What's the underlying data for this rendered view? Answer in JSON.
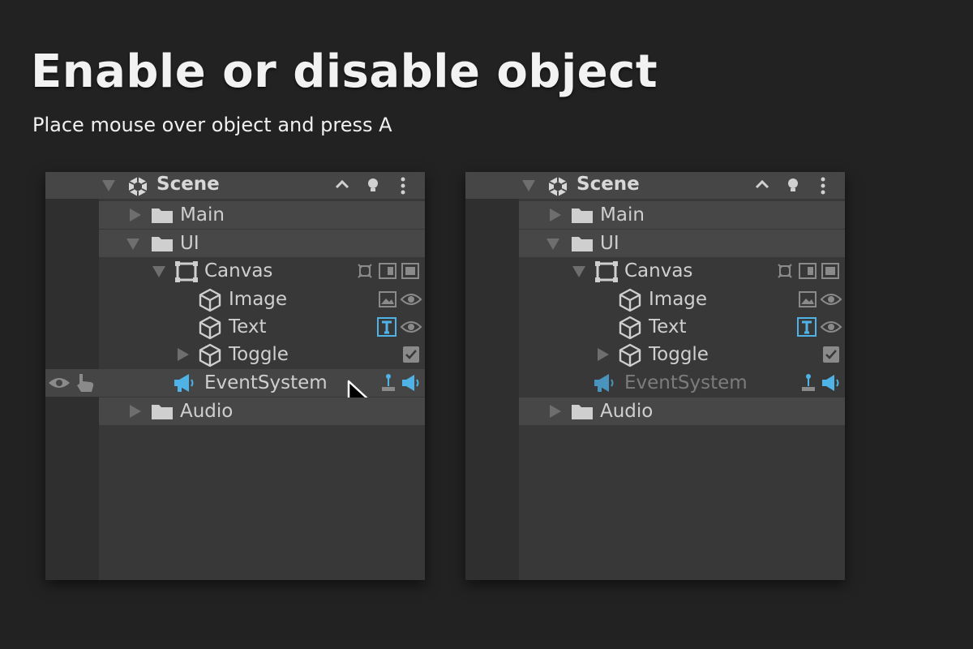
{
  "heading": {
    "title": "Enable or disable object",
    "subtitle": "Place mouse over object and press A"
  },
  "panels": [
    {
      "state": "before",
      "hovered_item": "EventSystem",
      "eventsystem_enabled": true,
      "header": {
        "label": "Scene"
      },
      "items": {
        "main": "Main",
        "ui": "UI",
        "canvas": "Canvas",
        "image": "Image",
        "text": "Text",
        "toggle": "Toggle",
        "eventsystem": "EventSystem",
        "audio": "Audio"
      }
    },
    {
      "state": "after",
      "eventsystem_enabled": false,
      "header": {
        "label": "Scene"
      },
      "items": {
        "main": "Main",
        "ui": "UI",
        "canvas": "Canvas",
        "image": "Image",
        "text": "Text",
        "toggle": "Toggle",
        "eventsystem": "EventSystem",
        "audio": "Audio"
      }
    }
  ],
  "colors": {
    "background": "#222222",
    "panel": "#383838",
    "row_highlight": "#474747",
    "accent_blue": "#4fb3e8",
    "text_dim": "#7c7c7c"
  },
  "icons": [
    "unity-scene-icon",
    "folder-icon",
    "canvas-icon",
    "cube-icon",
    "megaphone-icon",
    "eye-icon",
    "hand-pointer-icon",
    "image-component-icon",
    "text-component-icon",
    "checkbox-icon",
    "joystick-icon",
    "chevron-up-icon",
    "lightbulb-icon",
    "kebab-menu-icon",
    "mouse-cursor-icon"
  ]
}
